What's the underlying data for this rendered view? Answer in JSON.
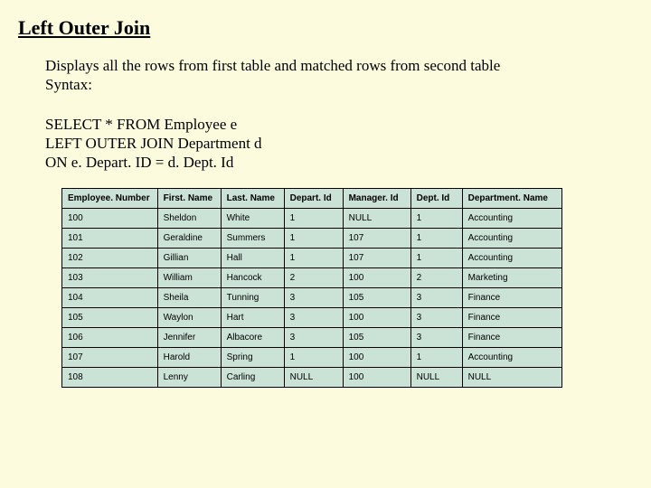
{
  "title": "Left Outer Join",
  "desc_line1": "Displays all the rows from first table and matched rows from second table",
  "desc_line2": "Syntax:",
  "sql_line1": "SELECT * FROM Employee e",
  "sql_line2": "LEFT OUTER JOIN Department d",
  "sql_line3": "ON e. Depart. ID = d. Dept. Id",
  "table": {
    "headers": [
      "Employee. Number",
      "First. Name",
      "Last. Name",
      "Depart. Id",
      "Manager. Id",
      "Dept. Id",
      "Department. Name"
    ],
    "rows": [
      [
        "100",
        "Sheldon",
        "White",
        "1",
        "NULL",
        "1",
        "Accounting"
      ],
      [
        "101",
        "Geraldine",
        "Summers",
        "1",
        "107",
        "1",
        "Accounting"
      ],
      [
        "102",
        "Gillian",
        "Hall",
        "1",
        "107",
        "1",
        "Accounting"
      ],
      [
        "103",
        "William",
        "Hancock",
        "2",
        "100",
        "2",
        "Marketing"
      ],
      [
        "104",
        "Sheila",
        "Tunning",
        "3",
        "105",
        "3",
        "Finance"
      ],
      [
        "105",
        "Waylon",
        "Hart",
        "3",
        "100",
        "3",
        "Finance"
      ],
      [
        "106",
        "Jennifer",
        "Albacore",
        "3",
        "105",
        "3",
        "Finance"
      ],
      [
        "107",
        "Harold",
        "Spring",
        "1",
        "100",
        "1",
        "Accounting"
      ],
      [
        "108",
        "Lenny",
        "Carling",
        "NULL",
        "100",
        "NULL",
        "NULL"
      ]
    ]
  }
}
